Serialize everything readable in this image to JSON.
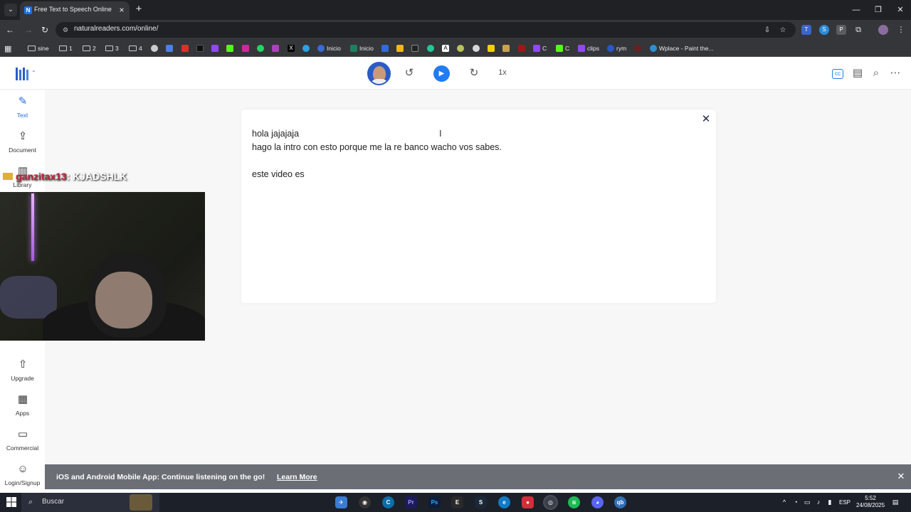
{
  "browser": {
    "tab_title": "Free Text to Speech Online with",
    "url": "naturalreaders.com/online/",
    "new_tab_label": "+",
    "tab_favicon_text": "N"
  },
  "bookmarks": [
    {
      "label": "sine",
      "type": "folder"
    },
    {
      "label": "1",
      "type": "folder"
    },
    {
      "label": "2",
      "type": "folder"
    },
    {
      "label": "3",
      "type": "folder"
    },
    {
      "label": "4",
      "type": "folder"
    },
    {
      "label": "Inicio",
      "type": "link"
    },
    {
      "label": "Inicio",
      "type": "link"
    },
    {
      "label": "C",
      "type": "link"
    },
    {
      "label": "C",
      "type": "link"
    },
    {
      "label": "clips",
      "type": "link"
    },
    {
      "label": "rym",
      "type": "link"
    },
    {
      "label": "Wplace - Paint the...",
      "type": "link"
    }
  ],
  "player": {
    "speed": "1x"
  },
  "sidebar": {
    "items": [
      {
        "label": "Text",
        "icon": "edit-icon",
        "active": true
      },
      {
        "label": "Document",
        "icon": "upload-icon"
      },
      {
        "label": "Library",
        "icon": "library-icon"
      },
      {
        "label": "Upgrade",
        "icon": "upgrade-icon"
      },
      {
        "label": "Apps",
        "icon": "apps-icon"
      },
      {
        "label": "Commercial",
        "icon": "briefcase-icon"
      },
      {
        "label": "Login/Signup",
        "icon": "user-icon"
      }
    ]
  },
  "editor": {
    "lines": [
      "hola jajajaja",
      "hago la intro con esto porque me la re banco wacho vos sabes.",
      "",
      "este video es"
    ]
  },
  "banner": {
    "text": "iOS and Android Mobile App: Continue listening on the go!",
    "link": "Learn More"
  },
  "stream_overlay": {
    "username": "ganzitax13",
    "message": ": KJADSHLK"
  },
  "taskbar": {
    "search_placeholder": "Buscar",
    "language": "ESP",
    "time": "5:52",
    "date": "24/08/2025"
  },
  "colors": {
    "accent": "#1f7cf2",
    "banner_bg": "#6b6e75",
    "chrome_dark": "#202124"
  }
}
